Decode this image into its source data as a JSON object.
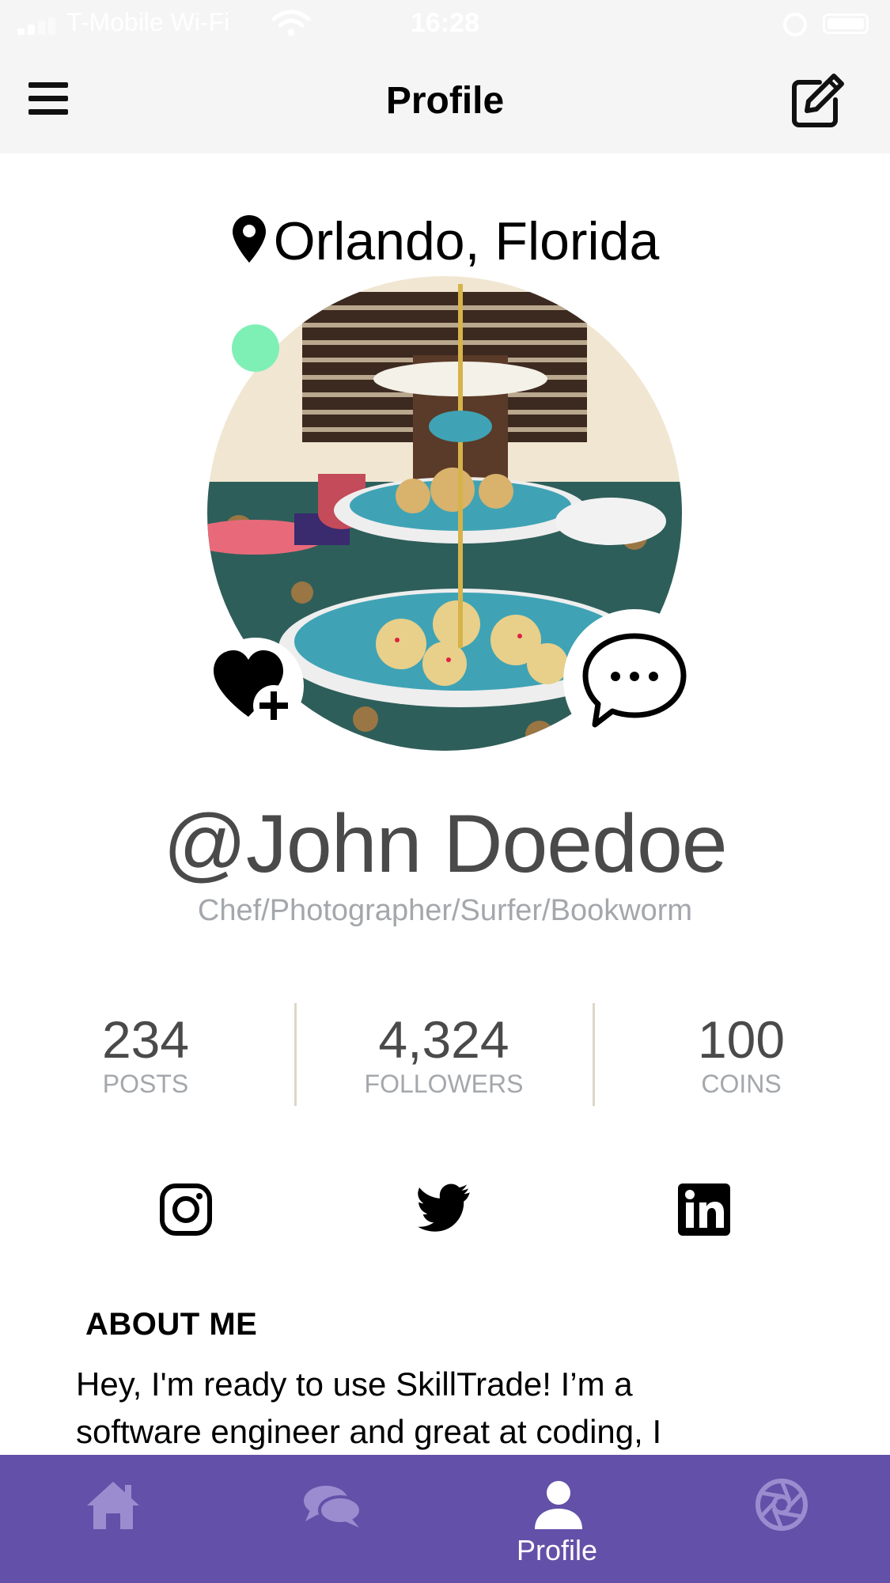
{
  "status_bar": {
    "carrier": "T-Mobile Wi-Fi",
    "time": "16:28"
  },
  "nav": {
    "title": "Profile",
    "menu_icon": "hamburger-menu-icon",
    "edit_icon": "edit-icon"
  },
  "profile": {
    "location_city": "Orlando,",
    "location_state": "Florida",
    "username": "@John Doedoe",
    "bio": "Chef/Photographer/Surfer/Bookworm",
    "online_status_color": "#7ff0b5"
  },
  "stats": [
    {
      "value": "234",
      "label": "POSTS"
    },
    {
      "value": "4,324",
      "label": "FOLLOWERS"
    },
    {
      "value": "100",
      "label": "COINS"
    }
  ],
  "social": [
    "instagram-icon",
    "twitter-icon",
    "linkedin-icon"
  ],
  "about": {
    "title": "ABOUT ME",
    "text_line1": "Hey, I'm ready to use SkillTrade! I’m a",
    "text_line2": "software engineer and great at coding, I"
  },
  "tab_bar": {
    "active_tab_label": "Profile",
    "background": "#6350a8",
    "tabs": [
      "home-icon",
      "chat-icon",
      "profile-icon",
      "aperture-icon"
    ]
  }
}
